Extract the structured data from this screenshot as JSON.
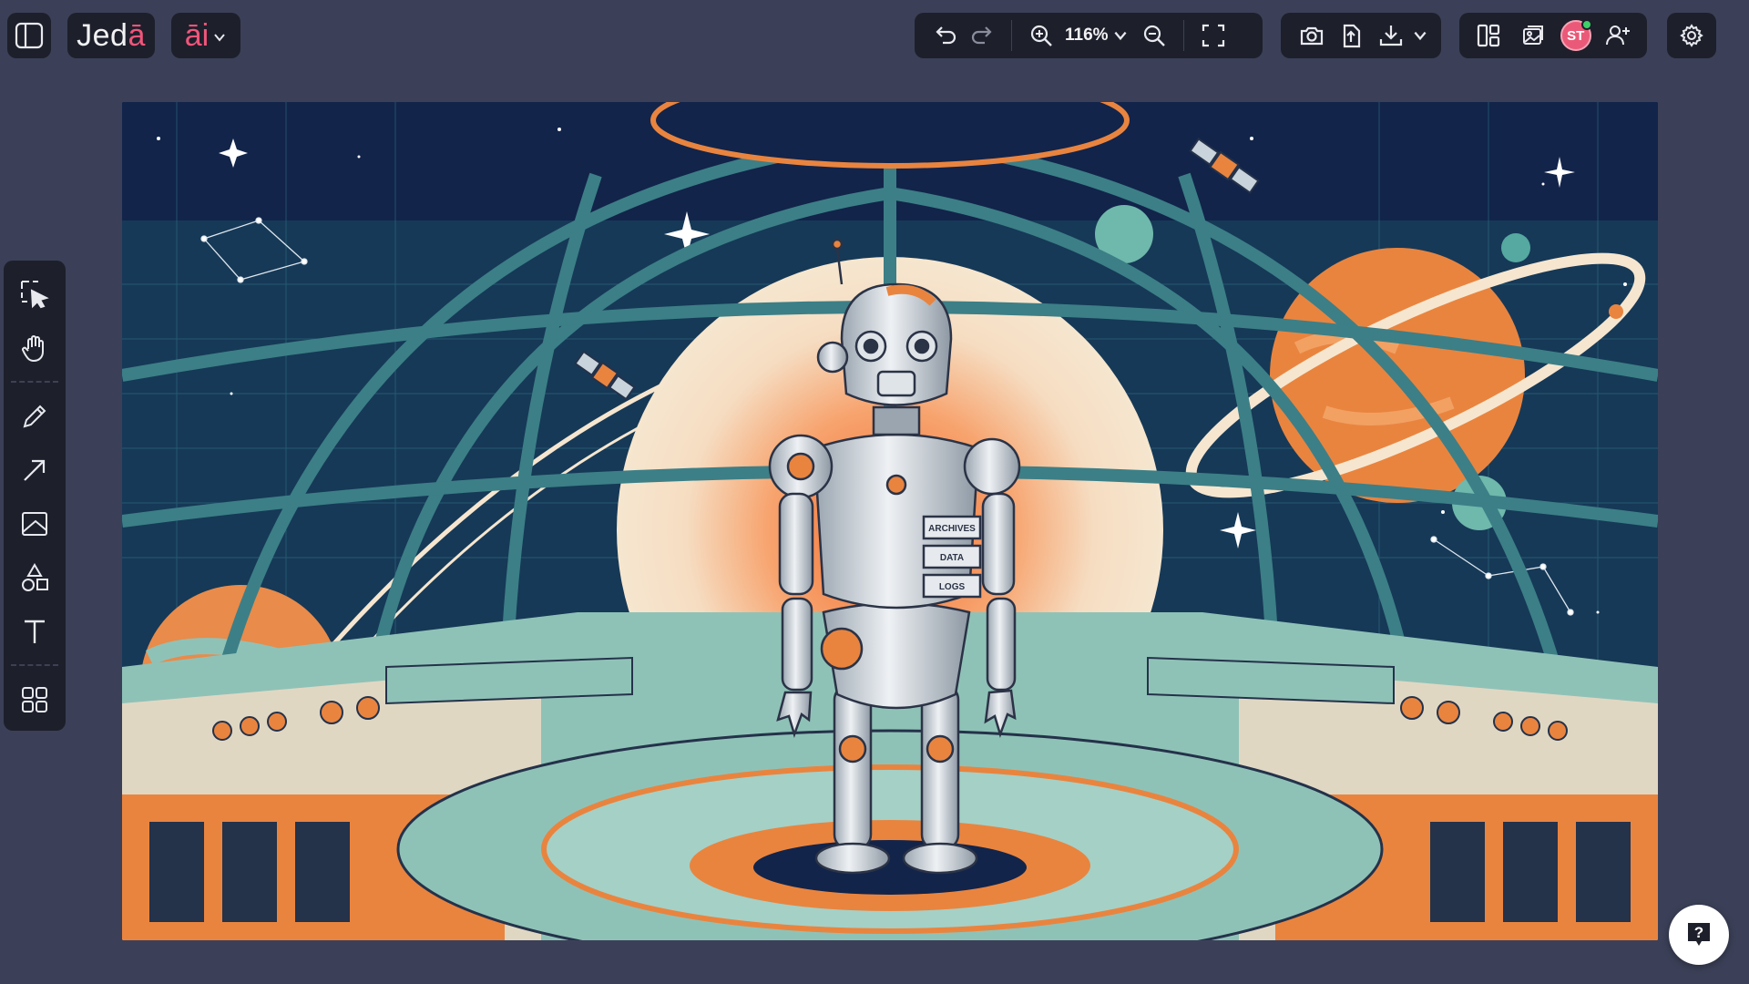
{
  "app": {
    "logo_main": "Jed",
    "logo_accent": "ā",
    "ai_label": "āi"
  },
  "toolbar_top": {
    "zoom_level": "116%",
    "avatar_initials": "ST"
  },
  "canvas": {
    "panel_labels": [
      "ARCHIVES",
      "DATA",
      "LOGS"
    ]
  },
  "left_tools": [
    {
      "name": "select-tool",
      "icon": "select-arrow-icon"
    },
    {
      "name": "hand-tool",
      "icon": "hand-icon"
    },
    {
      "name": "pencil-tool",
      "icon": "pencil-icon"
    },
    {
      "name": "arrow-tool",
      "icon": "arrow-icon"
    },
    {
      "name": "image-tool",
      "icon": "image-icon"
    },
    {
      "name": "shapes-tool",
      "icon": "shapes-icon"
    },
    {
      "name": "text-tool",
      "icon": "text-icon"
    },
    {
      "name": "components-tool",
      "icon": "grid-icon"
    }
  ],
  "colors": {
    "background": "#3b4058",
    "panel": "#1d1f2b",
    "brand_pink": "#f0567a",
    "online_green": "#3fcf6a"
  }
}
